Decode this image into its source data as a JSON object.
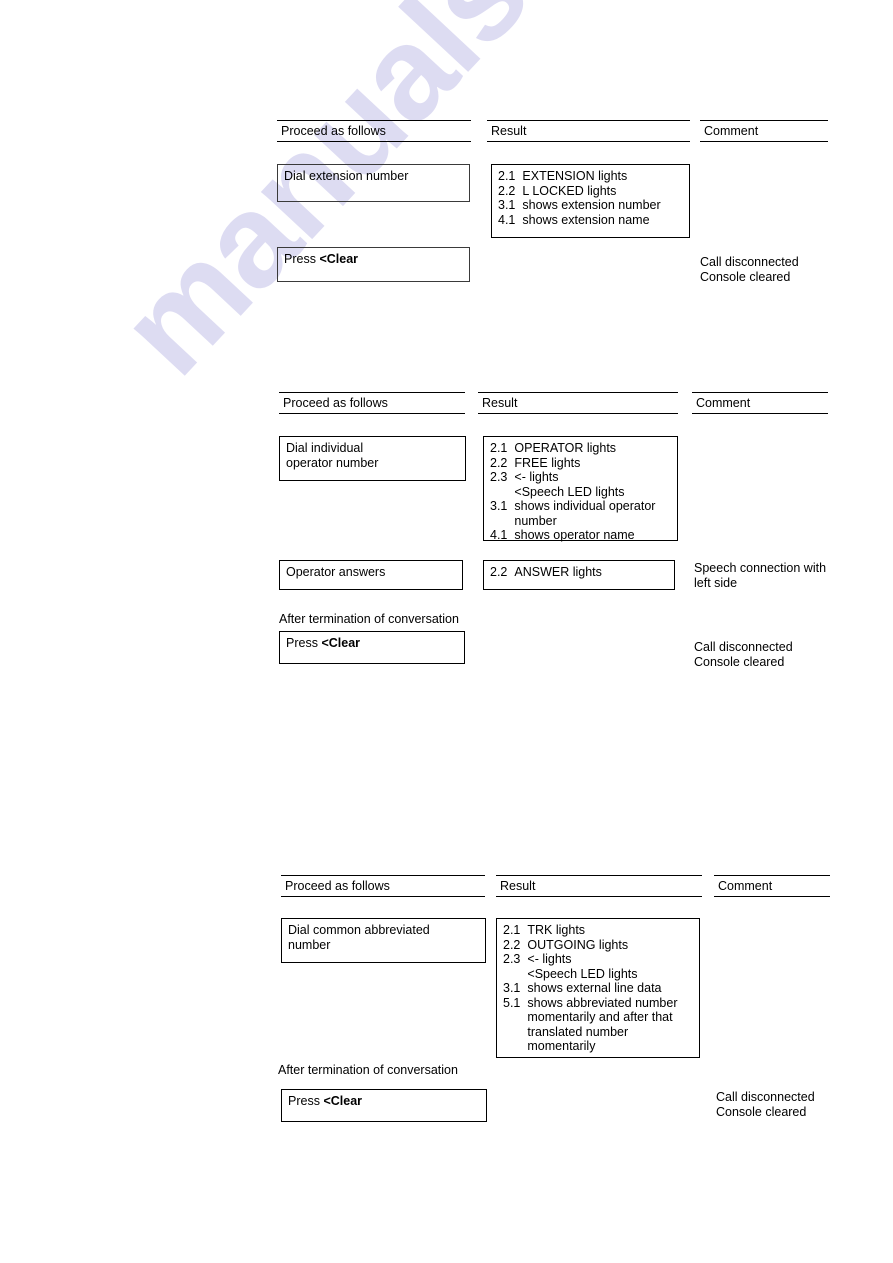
{
  "watermark": {
    "text": "manualshive.com"
  },
  "sections": [
    {
      "id": "section-extension-call",
      "headers": {
        "col1": "Proceed as follows",
        "col2": "Result",
        "col3": "Comment"
      },
      "action_boxes": [
        {
          "name": "dial-extension-number",
          "lines": [
            "Dial extension number"
          ]
        },
        {
          "name": "press-clear",
          "prefix": "Press ",
          "bold": "<Clear"
        }
      ],
      "result_box": {
        "name": "result-extension",
        "items": [
          {
            "num": "2.1",
            "text": "EXTENSION lights"
          },
          {
            "num": "2.2",
            "text": "L LOCKED lights"
          },
          {
            "num": "3.1",
            "text": "shows extension number"
          },
          {
            "num": "4.1",
            "text": "shows extension name"
          }
        ]
      },
      "comments": [
        {
          "name": "comment-call-disconnected",
          "lines": [
            "Call disconnected",
            "Console cleared"
          ]
        }
      ]
    },
    {
      "id": "section-individual-operator-call",
      "headers": {
        "col1": "Proceed as follows",
        "col2": "Result",
        "col3": "Comment"
      },
      "action_boxes": [
        {
          "name": "dial-individual-operator-number",
          "lines": [
            "Dial individual",
            "operator number"
          ]
        },
        {
          "name": "operator-answers",
          "lines": [
            "Operator answers"
          ]
        },
        {
          "name": "press-clear",
          "prefix": "Press ",
          "bold": "<Clear"
        }
      ],
      "result_boxes": [
        {
          "name": "result-individual-operator",
          "items": [
            {
              "num": "2.1",
              "text": "OPERATOR lights"
            },
            {
              "num": "2.2",
              "text": "FREE lights"
            },
            {
              "num": "2.3",
              "text": "<- lights"
            },
            {
              "num": "",
              "text": "<Speech LED lights"
            },
            {
              "num": "3.1",
              "text": "shows individual operator"
            },
            {
              "num": "",
              "text": "number"
            },
            {
              "num": "4.1",
              "text": "shows operator name"
            }
          ]
        },
        {
          "name": "result-answer-lights",
          "items": [
            {
              "num": "2.2",
              "text": "ANSWER lights"
            }
          ]
        }
      ],
      "note": "After termination of conversation",
      "comments": [
        {
          "name": "comment-speech-connection",
          "lines": [
            "Speech connection with",
            "left side"
          ]
        },
        {
          "name": "comment-call-disconnected",
          "lines": [
            "Call disconnected",
            "Console cleared"
          ]
        }
      ]
    },
    {
      "id": "section-common-abbreviated-number",
      "headers": {
        "col1": "Proceed as follows",
        "col2": "Result",
        "col3": "Comment"
      },
      "action_boxes": [
        {
          "name": "dial-common-abbreviated-number",
          "lines": [
            "Dial common abbreviated",
            "number"
          ]
        },
        {
          "name": "press-clear",
          "prefix": "Press ",
          "bold": "<Clear"
        }
      ],
      "result_box": {
        "name": "result-abbreviated-number",
        "items": [
          {
            "num": "2.1",
            "text": "TRK lights"
          },
          {
            "num": "2.2",
            "text": "OUTGOING lights"
          },
          {
            "num": "2.3",
            "text": "<- lights"
          },
          {
            "num": "",
            "text": "<Speech LED lights"
          },
          {
            "num": "3.1",
            "text": "shows external line data"
          },
          {
            "num": "5.1",
            "text": "shows abbreviated number"
          },
          {
            "num": "",
            "text": "momentarily and after that"
          },
          {
            "num": "",
            "text": "translated number"
          },
          {
            "num": "",
            "text": "momentarily"
          }
        ]
      },
      "note": "After termination of conversation",
      "comments": [
        {
          "name": "comment-call-disconnected",
          "lines": [
            "Call disconnected",
            "Console cleared"
          ]
        }
      ]
    }
  ]
}
